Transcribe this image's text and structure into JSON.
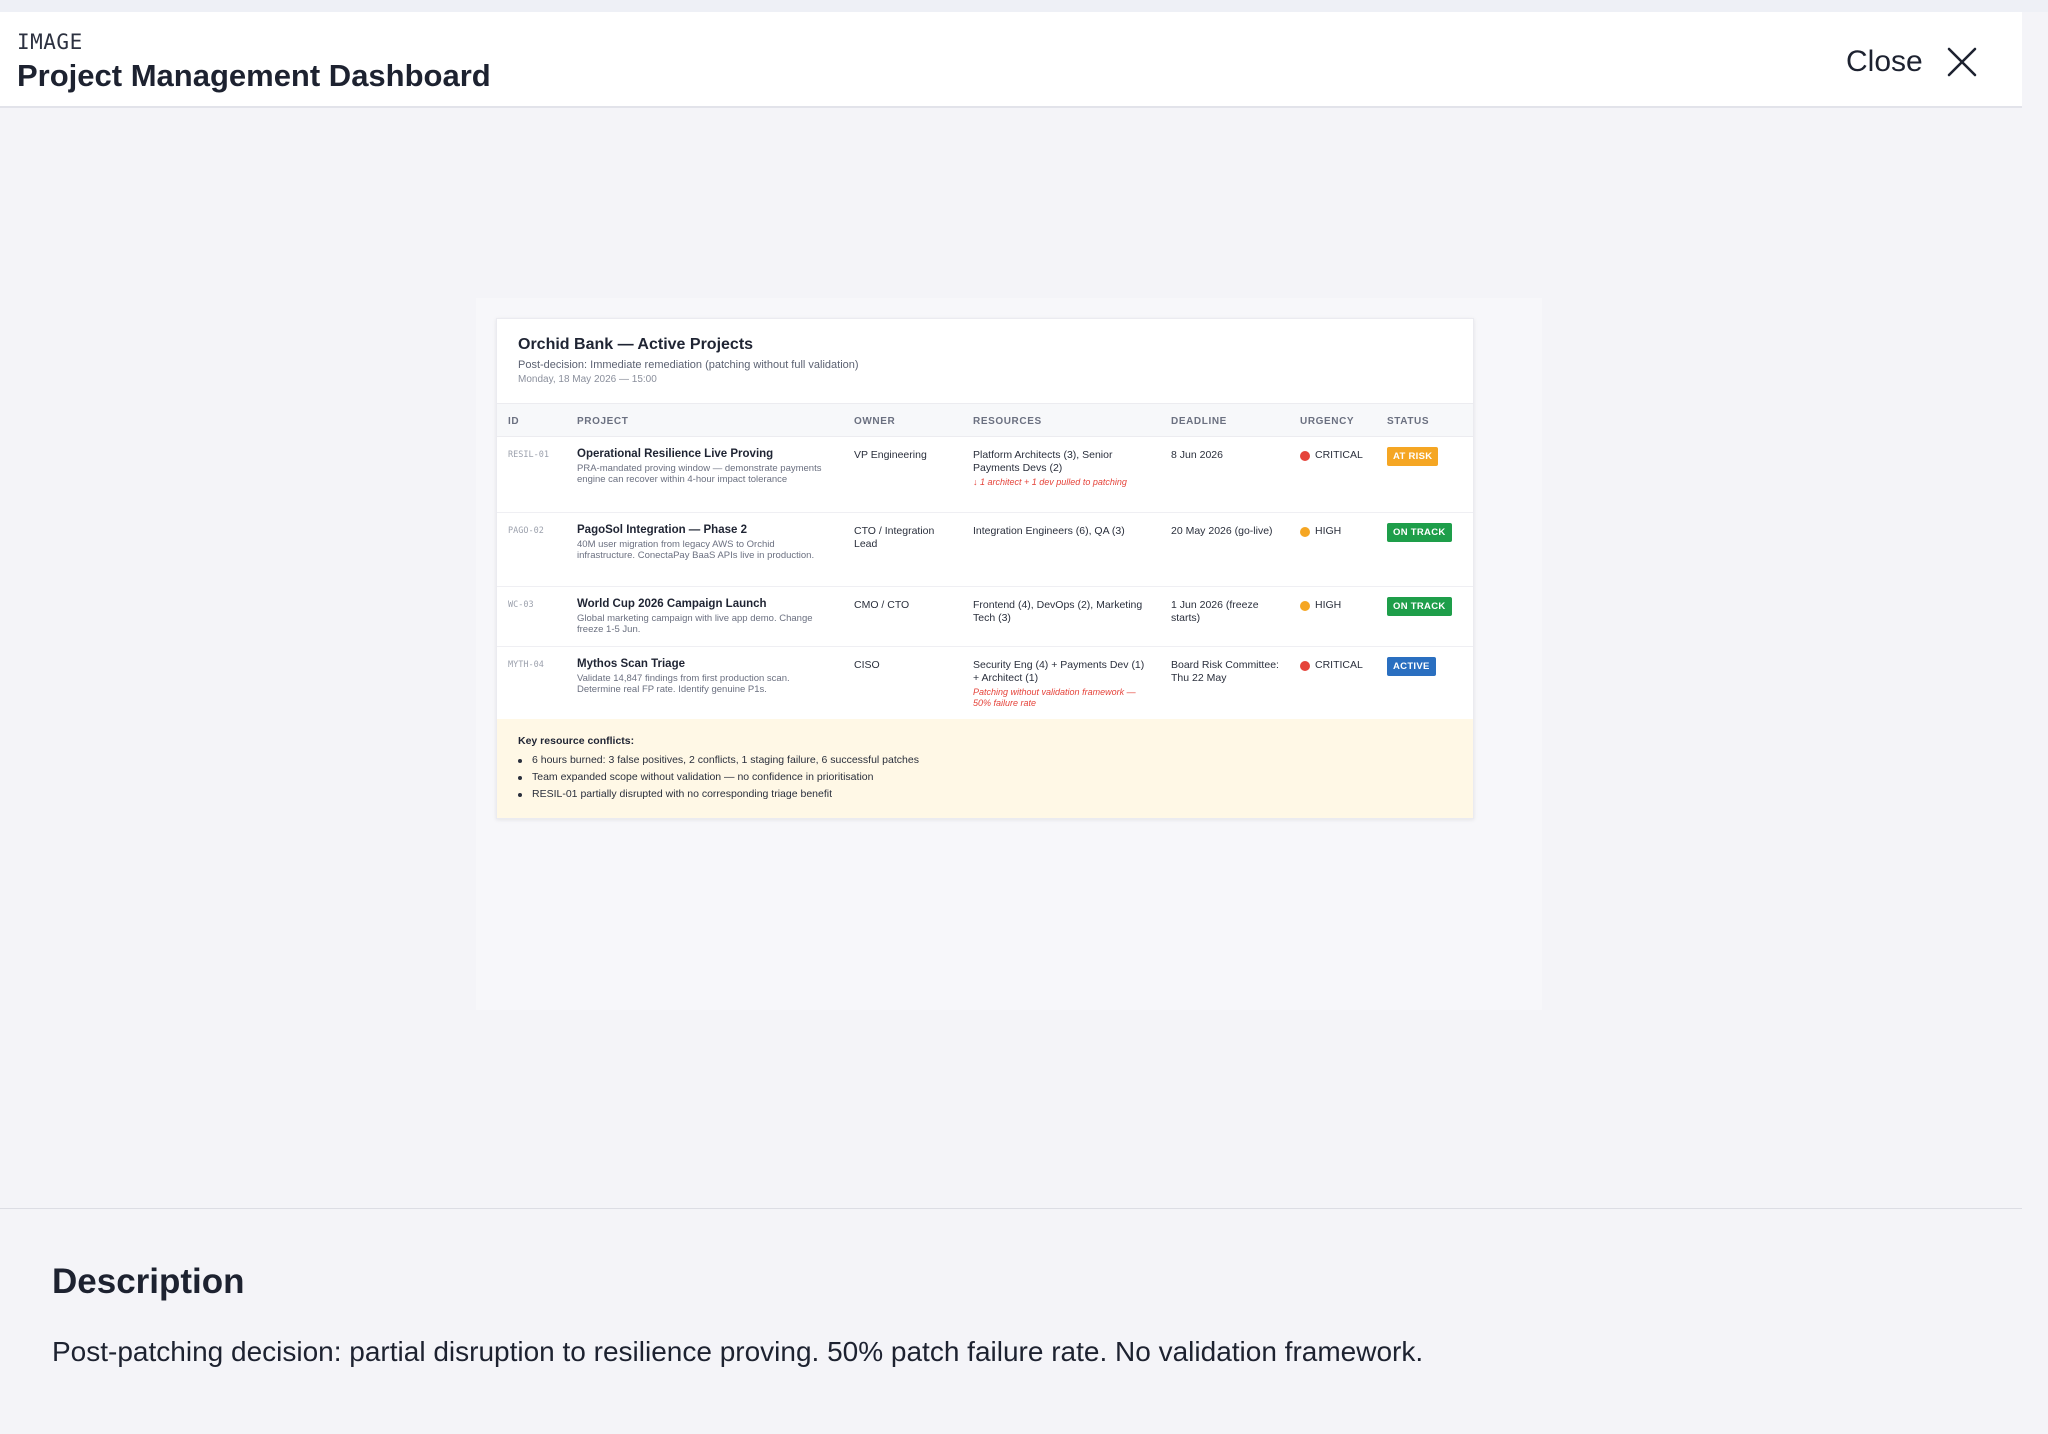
{
  "header": {
    "kind": "IMAGE",
    "title": "Project Management Dashboard",
    "close_label": "Close"
  },
  "dashboard": {
    "title": "Orchid Bank — Active Projects",
    "subtitle": "Post-decision: Immediate remediation (patching without full validation)",
    "date": "Monday, 18 May 2026 — 15:00",
    "columns": [
      "ID",
      "PROJECT",
      "OWNER",
      "RESOURCES",
      "DEADLINE",
      "URGENCY",
      "STATUS"
    ],
    "rows": [
      {
        "id": "RESIL-01",
        "name": "Operational Resilience Live Proving",
        "desc": "PRA-mandated proving window — demonstrate payments engine can recover within 4-hour impact tolerance",
        "owner": "VP Engineering",
        "resources": "Platform Architects (3), Senior Payments Devs (2)",
        "resource_note": "↓ 1 architect + 1 dev pulled to patching",
        "deadline": "8 Jun 2026",
        "urgency": "CRITICAL",
        "urgency_color": "#e5433a",
        "status": "AT RISK",
        "status_color": "#f5a623"
      },
      {
        "id": "PAGO-02",
        "name": "PagoSol Integration — Phase 2",
        "desc": "40M user migration from legacy AWS to Orchid infrastructure. ConectaPay BaaS APIs live in production.",
        "owner": "CTO / Integration Lead",
        "resources": "Integration Engineers (6), QA (3)",
        "resource_note": "",
        "deadline": "20 May 2026 (go-live)",
        "urgency": "HIGH",
        "urgency_color": "#f5a623",
        "status": "ON TRACK",
        "status_color": "#1e9e4a"
      },
      {
        "id": "WC-03",
        "name": "World Cup 2026 Campaign Launch",
        "desc": "Global marketing campaign with live app demo. Change freeze 1-5 Jun.",
        "owner": "CMO / CTO",
        "resources": "Frontend (4), DevOps (2), Marketing Tech (3)",
        "resource_note": "",
        "deadline": "1 Jun 2026 (freeze starts)",
        "urgency": "HIGH",
        "urgency_color": "#f5a623",
        "status": "ON TRACK",
        "status_color": "#1e9e4a"
      },
      {
        "id": "MYTH-04",
        "name": "Mythos Scan Triage",
        "desc": "Validate 14,847 findings from first production scan. Determine real FP rate. Identify genuine P1s.",
        "owner": "CISO",
        "resources": "Security Eng (4) + Payments Dev (1) + Architect (1)",
        "resource_note": "Patching without validation framework — 50% failure rate",
        "deadline": "Board Risk Committee: Thu 22 May",
        "urgency": "CRITICAL",
        "urgency_color": "#e5433a",
        "status": "ACTIVE",
        "status_color": "#2a6fc0"
      }
    ],
    "conflicts": {
      "title": "Key resource conflicts:",
      "items": [
        "6 hours burned: 3 false positives, 2 conflicts, 1 staging failure, 6 successful patches",
        "Team expanded scope without validation — no confidence in prioritisation",
        "RESIL-01 partially disrupted with no corresponding triage benefit"
      ]
    }
  },
  "description": {
    "heading": "Description",
    "text": "Post-patching decision: partial disruption to resilience proving. 50% patch failure rate. No validation framework."
  }
}
